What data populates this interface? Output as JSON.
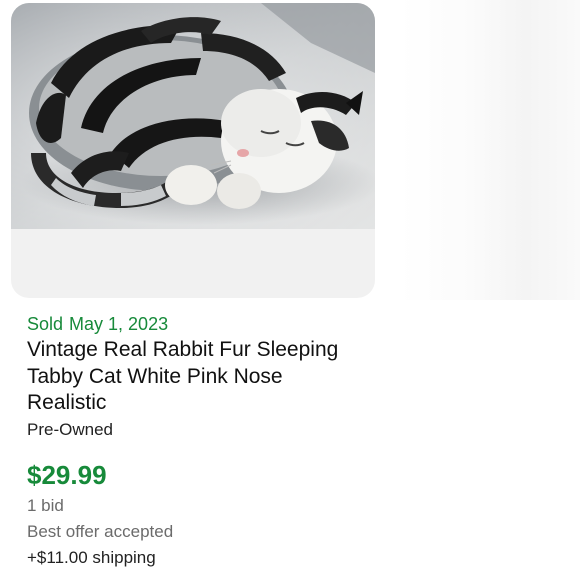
{
  "listing": {
    "image_alt": "Vintage Real Rabbit Fur Sleeping Tabby Cat White Pink Nose Realistic",
    "status": "Sold",
    "sold_date": "May 1, 2023",
    "title": "Vintage Real Rabbit Fur Sleeping Tabby Cat White Pink Nose Realistic",
    "condition": "Pre-Owned",
    "price": "$29.99",
    "bids": "1 bid",
    "offer_status": "Best offer accepted",
    "shipping": "+$11.00 shipping"
  },
  "colors": {
    "sold_green": "#178a3a",
    "price_green": "#178a3a",
    "muted_text": "#6b6b6b",
    "card_background": "#f1f1f1"
  }
}
